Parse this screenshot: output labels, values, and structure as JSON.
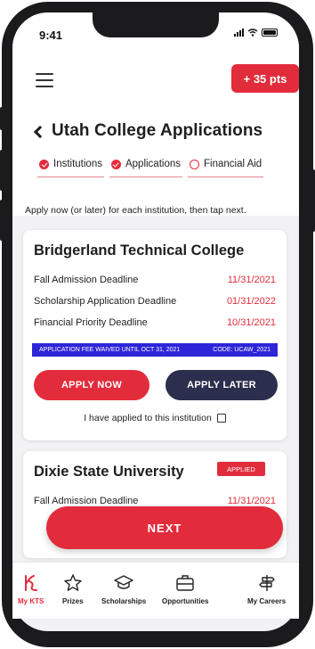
{
  "status": {
    "time": "9:41"
  },
  "header": {
    "points_label": "+ 35 pts",
    "title": "Utah College Applications"
  },
  "tabs": [
    {
      "label": "Institutions",
      "complete": true
    },
    {
      "label": "Applications",
      "complete": true
    },
    {
      "label": "Financial Aid",
      "complete": false
    }
  ],
  "instructions": "Apply now (or later) for each institution, then tap next.",
  "institutions": [
    {
      "name": "Bridgerland Technical College",
      "deadlines": [
        {
          "label": "Fall Admission Deadline",
          "date": "11/31/2021"
        },
        {
          "label": "Scholarship Application Deadline",
          "date": "01/31/2022"
        },
        {
          "label": "Financial Priority Deadline",
          "date": "10/31/2021"
        }
      ],
      "fee_waiver": "APPLICATION FEE WAIVED UNTIL OCT 31, 2021",
      "fee_code": "CODE: UCAW_2021",
      "apply_now_label": "APPLY NOW",
      "apply_later_label": "APPLY LATER",
      "applied_checkbox_label": "I have applied to this institution"
    },
    {
      "name": "Dixie State University",
      "badge": "APPLIED",
      "deadlines": [
        {
          "label": "Fall Admission Deadline",
          "date": "11/31/2021"
        }
      ]
    }
  ],
  "next_label": "NEXT",
  "bottom_nav": [
    {
      "label": "My KTS",
      "icon": "kts-logo-icon",
      "active": true
    },
    {
      "label": "Prizes",
      "icon": "star-icon",
      "active": false
    },
    {
      "label": "Scholarships",
      "icon": "graduation-cap-icon",
      "active": false
    },
    {
      "label": "Opportunities",
      "icon": "briefcase-icon",
      "active": false
    },
    {
      "label": "My Careers",
      "icon": "signpost-icon",
      "active": false
    }
  ],
  "colors": {
    "accent": "#e22c3c",
    "dark_button": "#2b2e4c",
    "banner": "#2e25d8"
  }
}
